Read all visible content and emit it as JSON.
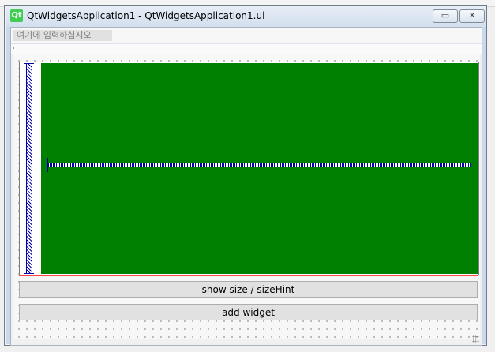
{
  "window": {
    "logo_text": "Qt",
    "title": "QtWidgetsApplication1 - QtWidgetsApplication1.ui",
    "minimize_glyph": "▭",
    "close_glyph": "✕"
  },
  "menubar": {
    "placeholder": "여기에 입력하십시오"
  },
  "form": {
    "green_color": "#008000",
    "spacer_color": "#0000a8",
    "buttons": {
      "size_label": "show size / sizeHint",
      "add_label": "add widget"
    }
  }
}
